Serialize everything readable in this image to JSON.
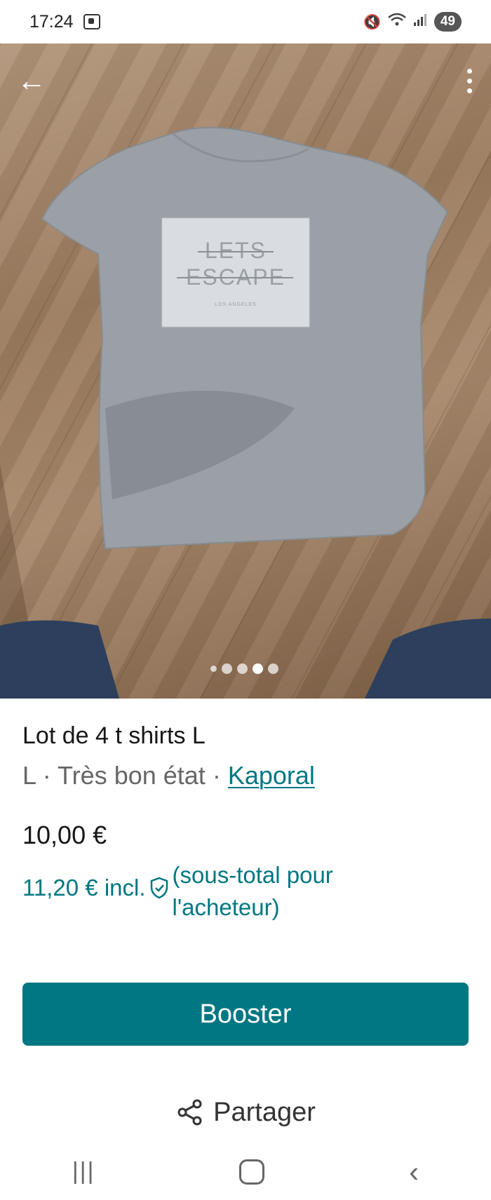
{
  "status_bar": {
    "time": "17:24",
    "battery": "49"
  },
  "photo": {
    "shirt_print_line1": "LETS",
    "shirt_print_line2": "ESCAPE",
    "shirt_print_line3": "LOS ANGELES",
    "carousel_total": 5,
    "carousel_active_index": 3
  },
  "item": {
    "title": "Lot de 4 t shirts L",
    "size": "L",
    "separator": " · ",
    "condition": "Très bon état",
    "brand": "Kaporal",
    "price": "10,00 €",
    "buyer_price": "11,20 € incl.",
    "buyer_note": "(sous-total pour l'acheteur)"
  },
  "actions": {
    "boost_label": "Booster",
    "share_label": "Partager"
  },
  "colors": {
    "accent": "#007782",
    "text": "#171717",
    "muted": "#666666"
  },
  "icons": {
    "back": "back-arrow-icon",
    "more": "more-vertical-icon",
    "shield": "shield-check-icon",
    "share": "share-icon"
  }
}
